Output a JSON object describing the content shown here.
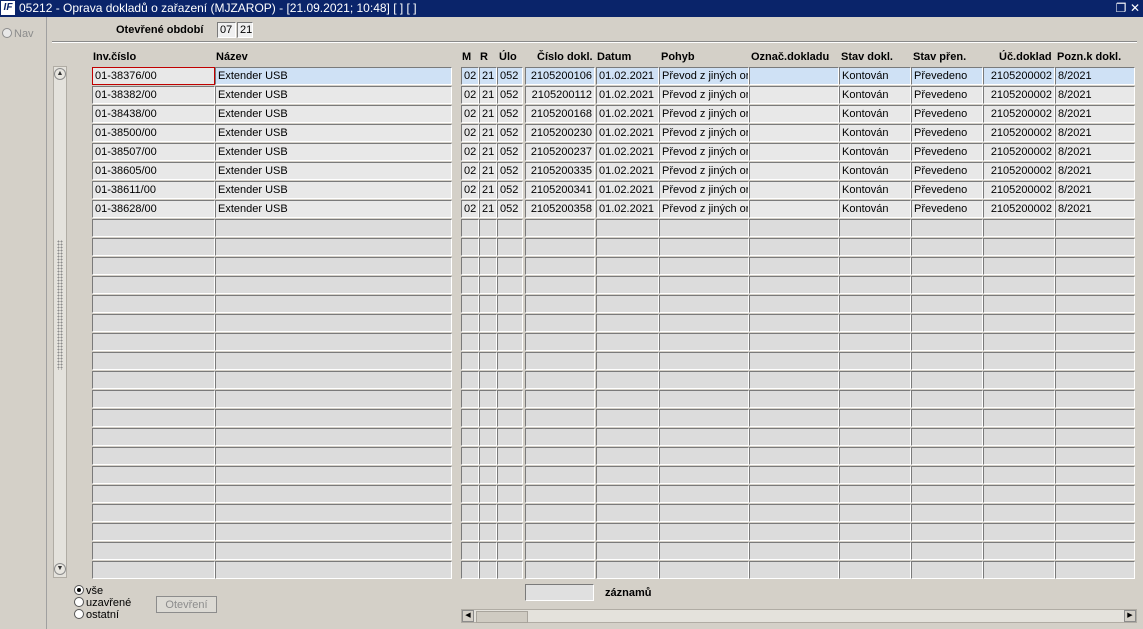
{
  "window": {
    "title": "05212 - Oprava dokladů o zařazení (MJZAROP) - [21.09.2021; 10:48]  [ ]  [ ]",
    "icon_text": "IF"
  },
  "nav": {
    "label": "Nav"
  },
  "period": {
    "label": "Otevřené období",
    "month": "07",
    "year": "21"
  },
  "columns": [
    {
      "key": "inv",
      "label": "Inv.číslo"
    },
    {
      "key": "nazev",
      "label": "Název"
    },
    {
      "key": "m",
      "label": "M"
    },
    {
      "key": "r",
      "label": "R"
    },
    {
      "key": "ulo",
      "label": "Úlo"
    },
    {
      "key": "cislo",
      "label": "Číslo dokl."
    },
    {
      "key": "datum",
      "label": "Datum"
    },
    {
      "key": "pohyb",
      "label": "Pohyb"
    },
    {
      "key": "oznac",
      "label": "Označ.dokladu"
    },
    {
      "key": "stav",
      "label": "Stav dokl."
    },
    {
      "key": "prenos",
      "label": "Stav přen."
    },
    {
      "key": "ucdoklad",
      "label": "Úč.doklad"
    },
    {
      "key": "pozn",
      "label": "Pozn.k dokl."
    }
  ],
  "rows": [
    {
      "inv": "01-38376/00",
      "nazev": "Extender USB",
      "m": "02",
      "r": "21",
      "ulo": "052",
      "cislo": "2105200106",
      "datum": "01.02.2021",
      "pohyb": "Převod z jiných org.",
      "oznac": "",
      "stav": "Kontován",
      "prenos": "Převedeno",
      "ucdoklad": "2105200002",
      "pozn": "8/2021"
    },
    {
      "inv": "01-38382/00",
      "nazev": "Extender USB",
      "m": "02",
      "r": "21",
      "ulo": "052",
      "cislo": "2105200112",
      "datum": "01.02.2021",
      "pohyb": "Převod z jiných org.",
      "oznac": "",
      "stav": "Kontován",
      "prenos": "Převedeno",
      "ucdoklad": "2105200002",
      "pozn": "8/2021"
    },
    {
      "inv": "01-38438/00",
      "nazev": "Extender USB",
      "m": "02",
      "r": "21",
      "ulo": "052",
      "cislo": "2105200168",
      "datum": "01.02.2021",
      "pohyb": "Převod z jiných org.",
      "oznac": "",
      "stav": "Kontován",
      "prenos": "Převedeno",
      "ucdoklad": "2105200002",
      "pozn": "8/2021"
    },
    {
      "inv": "01-38500/00",
      "nazev": "Extender USB",
      "m": "02",
      "r": "21",
      "ulo": "052",
      "cislo": "2105200230",
      "datum": "01.02.2021",
      "pohyb": "Převod z jiných org.",
      "oznac": "",
      "stav": "Kontován",
      "prenos": "Převedeno",
      "ucdoklad": "2105200002",
      "pozn": "8/2021"
    },
    {
      "inv": "01-38507/00",
      "nazev": "Extender USB",
      "m": "02",
      "r": "21",
      "ulo": "052",
      "cislo": "2105200237",
      "datum": "01.02.2021",
      "pohyb": "Převod z jiných org.",
      "oznac": "",
      "stav": "Kontován",
      "prenos": "Převedeno",
      "ucdoklad": "2105200002",
      "pozn": "8/2021"
    },
    {
      "inv": "01-38605/00",
      "nazev": "Extender USB",
      "m": "02",
      "r": "21",
      "ulo": "052",
      "cislo": "2105200335",
      "datum": "01.02.2021",
      "pohyb": "Převod z jiných org.",
      "oznac": "",
      "stav": "Kontován",
      "prenos": "Převedeno",
      "ucdoklad": "2105200002",
      "pozn": "8/2021"
    },
    {
      "inv": "01-38611/00",
      "nazev": "Extender USB",
      "m": "02",
      "r": "21",
      "ulo": "052",
      "cislo": "2105200341",
      "datum": "01.02.2021",
      "pohyb": "Převod z jiných org.",
      "oznac": "",
      "stav": "Kontován",
      "prenos": "Převedeno",
      "ucdoklad": "2105200002",
      "pozn": "8/2021"
    },
    {
      "inv": "01-38628/00",
      "nazev": "Extender USB",
      "m": "02",
      "r": "21",
      "ulo": "052",
      "cislo": "2105200358",
      "datum": "01.02.2021",
      "pohyb": "Převod z jiných org.",
      "oznac": "",
      "stav": "Kontován",
      "prenos": "Převedeno",
      "ucdoklad": "2105200002",
      "pozn": "8/2021"
    }
  ],
  "filter": {
    "options": [
      {
        "label": "vše",
        "selected": true
      },
      {
        "label": "uzavřené",
        "selected": false
      },
      {
        "label": "ostatní",
        "selected": false
      }
    ]
  },
  "open_button": {
    "label": "Otevření"
  },
  "records": {
    "count": "",
    "label": "záznamů"
  },
  "colors": {
    "selected_row": "#cfe1f5",
    "titlebar": "#0a246a",
    "active_cell_border": "#c00000"
  },
  "icons": {
    "restore": "restore-icon",
    "close": "close-icon",
    "scroll_up": "scroll-up-icon",
    "scroll_down": "scroll-down-icon"
  }
}
